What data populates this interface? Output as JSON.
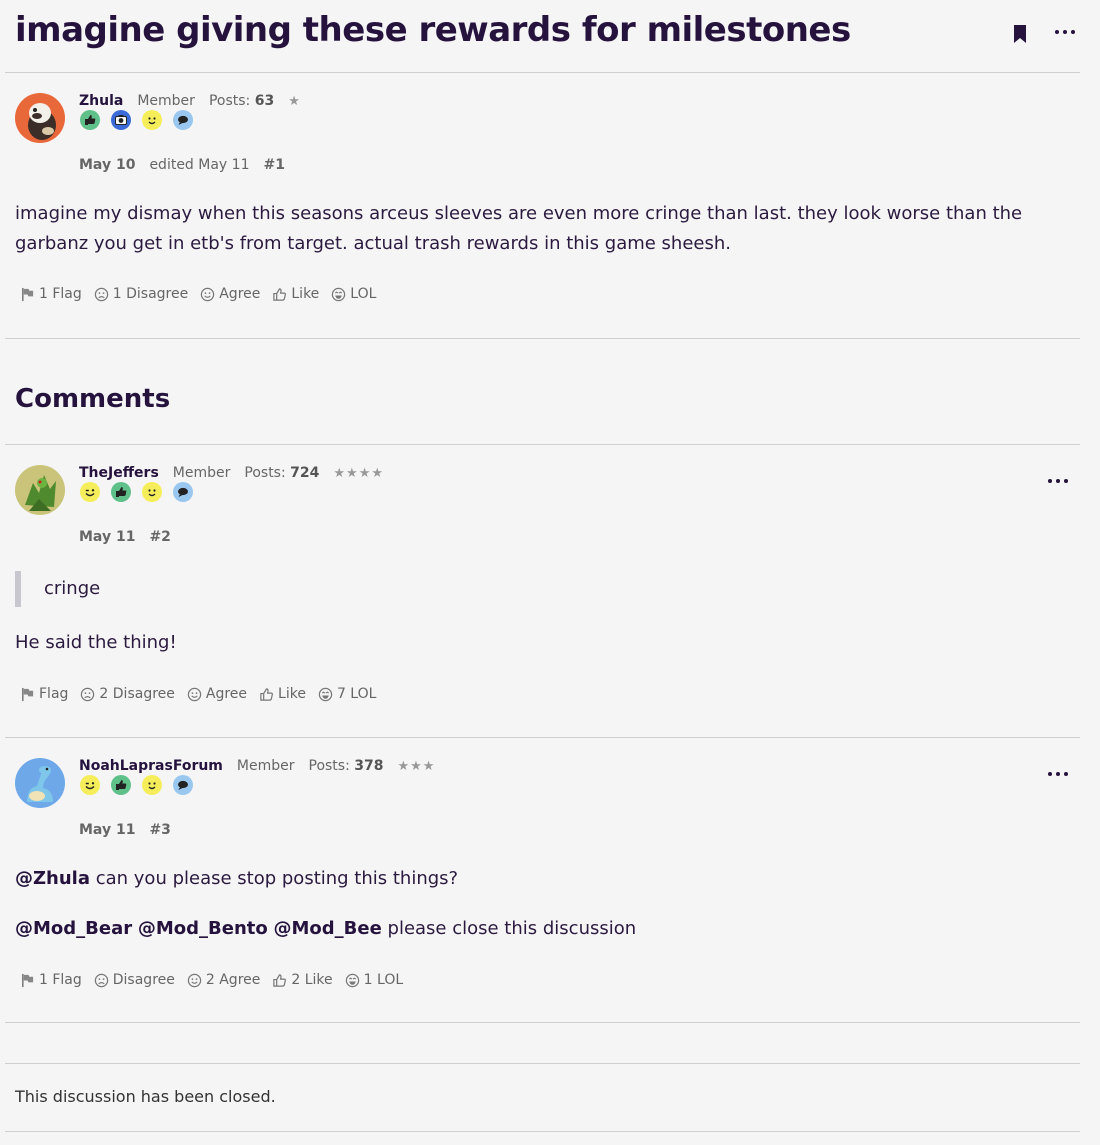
{
  "discussion": {
    "title": "imagine giving these rewards for milestones",
    "comments_heading": "Comments",
    "closed_notice": "This discussion has been closed."
  },
  "colors": {
    "title": "#25133d",
    "text": "#2b1a3f",
    "divider": "#cfcfcf",
    "background": "#f5f5f5"
  },
  "posts": [
    {
      "username": "Zhula",
      "role": "Member",
      "posts_label": "Posts:",
      "posts_count": "63",
      "stars": "★",
      "badges": [
        "thumbs-up-badge",
        "camera-badge",
        "smiley-badge",
        "speech-bubble-badge"
      ],
      "date": "May 10",
      "edited": "edited May 11",
      "number": "#1",
      "body": "imagine my dismay when this seasons arceus sleeves are even more cringe than last. they look worse than the garbanz you get in etb's from target. actual trash rewards in this game sheesh.",
      "reactions": {
        "flag": "1 Flag",
        "disagree": "1 Disagree",
        "agree": "Agree",
        "like": "Like",
        "lol": "LOL"
      }
    },
    {
      "username": "TheJeffers",
      "role": "Member",
      "posts_label": "Posts:",
      "posts_count": "724",
      "stars": "★★★★",
      "badges": [
        "wink-badge",
        "thumbs-up-badge",
        "smiley-badge",
        "speech-bubble-badge"
      ],
      "date": "May 11",
      "number": "#2",
      "quote": "cringe",
      "body": "He said the thing!",
      "reactions": {
        "flag": "Flag",
        "disagree": "2 Disagree",
        "agree": "Agree",
        "like": "Like",
        "lol": "7 LOL"
      }
    },
    {
      "username": "NoahLaprasForum",
      "role": "Member",
      "posts_label": "Posts:",
      "posts_count": "378",
      "stars": "★★★",
      "badges": [
        "wink-badge",
        "thumbs-up-badge",
        "smiley-badge",
        "speech-bubble-badge"
      ],
      "date": "May 11",
      "number": "#3",
      "line1_mention": "@Zhula",
      "line1_text": " can you please stop posting this things?",
      "line2_mentions": [
        "@Mod_Bear",
        "@Mod_Bento",
        "@Mod_Bee"
      ],
      "line2_text": " please close this discussion",
      "reactions": {
        "flag": "1 Flag",
        "disagree": "Disagree",
        "agree": "2 Agree",
        "like": "2 Like",
        "lol": "1 LOL"
      }
    }
  ]
}
